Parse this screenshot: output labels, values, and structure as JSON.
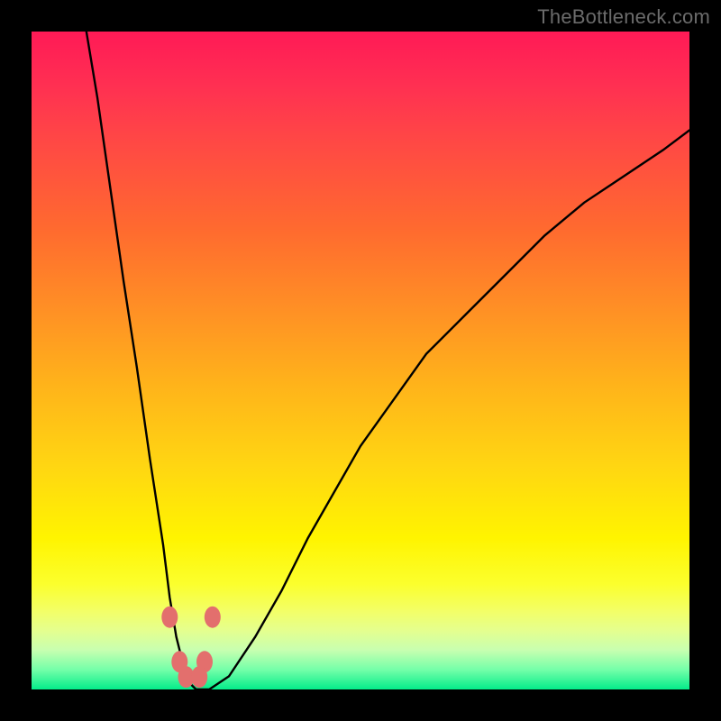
{
  "watermark": "TheBottleneck.com",
  "colors": {
    "background": "#000000",
    "curve": "#000000",
    "marker": "#e36f6d"
  },
  "chart_data": {
    "type": "line",
    "title": "",
    "xlabel": "",
    "ylabel": "",
    "xlim": [
      0,
      100
    ],
    "ylim": [
      0,
      100
    ],
    "grid": false,
    "legend": false,
    "note": "Single V-shaped curve. x is relative position across plot (0–100), y is height from bottom (0 = bottom/green, 100 = top/red). Values estimated from pixel positions; no numeric axes are shown.",
    "series": [
      {
        "name": "curve",
        "x": [
          8,
          10,
          12,
          14,
          16,
          18,
          20,
          21,
          22,
          23,
          24,
          25,
          27,
          30,
          34,
          38,
          42,
          46,
          50,
          55,
          60,
          66,
          72,
          78,
          84,
          90,
          96,
          100
        ],
        "values": [
          102,
          90,
          76,
          62,
          49,
          35,
          22,
          14,
          8,
          4,
          1,
          0,
          0,
          2,
          8,
          15,
          23,
          30,
          37,
          44,
          51,
          57,
          63,
          69,
          74,
          78,
          82,
          85
        ]
      }
    ],
    "markers": [
      {
        "x": 21.0,
        "y": 11.0
      },
      {
        "x": 27.5,
        "y": 11.0
      },
      {
        "x": 22.5,
        "y": 4.2
      },
      {
        "x": 26.3,
        "y": 4.2
      },
      {
        "x": 23.5,
        "y": 1.9
      },
      {
        "x": 25.5,
        "y": 1.9
      }
    ]
  }
}
